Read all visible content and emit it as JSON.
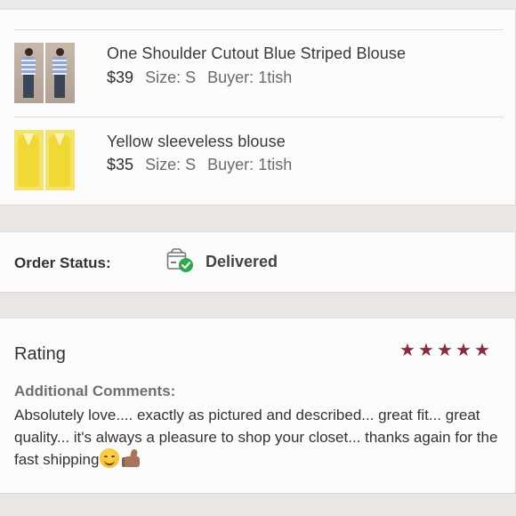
{
  "items": [
    {
      "title": "One Shoulder Cutout Blue Striped Blouse",
      "price": "$39",
      "size_label": "Size:",
      "size": "S",
      "buyer_label": "Buyer:",
      "buyer": "1tish"
    },
    {
      "title": "Yellow sleeveless blouse",
      "price": "$35",
      "size_label": "Size:",
      "size": "S",
      "buyer_label": "Buyer:",
      "buyer": "1tish"
    }
  ],
  "order_status": {
    "label": "Order Status:",
    "value": "Delivered",
    "icon": "package-delivered-icon",
    "check_color": "#2eaa4c"
  },
  "rating": {
    "title": "Rating",
    "stars": 5,
    "max_stars": 5,
    "star_color": "#8a2b3d",
    "comments_label": "Additional Comments:",
    "comments": "Absolutely love.... exactly as pictured and described... great fit... great quality... it's always a pleasure to shop your closet... thanks again for the fast shipping",
    "emojis": [
      "smiling-face-icon",
      "thumbs-up-icon"
    ]
  }
}
